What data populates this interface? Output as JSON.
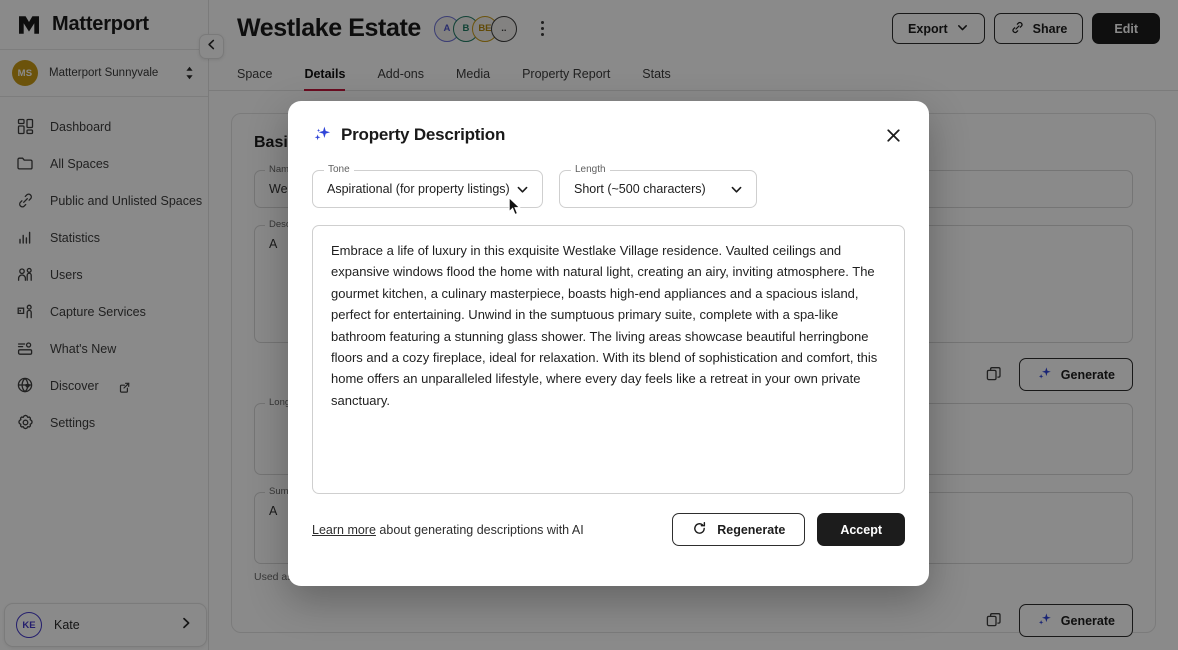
{
  "sidebar": {
    "brand": "Matterport",
    "brand_logo_icon": "matterport-logo-icon",
    "collapse_icon": "chevron-left-icon",
    "org": {
      "initials": "MS",
      "name": "Matterport Sunnyvale",
      "sort_icon": "sort-updown-icon",
      "avatar_color": "#c79a15"
    },
    "items": [
      {
        "label": "Dashboard",
        "icon": "dashboard-grid-icon",
        "external": false
      },
      {
        "label": "All Spaces",
        "icon": "folder-icon",
        "external": false
      },
      {
        "label": "Public and Unlisted Spaces",
        "icon": "link-chain-icon",
        "external": false
      },
      {
        "label": "Statistics",
        "icon": "bar-chart-icon",
        "external": false
      },
      {
        "label": "Users",
        "icon": "users-icon",
        "external": false
      },
      {
        "label": "Capture Services",
        "icon": "camera-person-icon",
        "external": false
      },
      {
        "label": "What's New",
        "icon": "list-toggle-icon",
        "external": false
      },
      {
        "label": "Discover",
        "icon": "globe-heart-icon",
        "external": true
      },
      {
        "label": "Settings",
        "icon": "gear-icon",
        "external": false
      }
    ],
    "user": {
      "initials": "KE",
      "name": "Kate",
      "chevron_icon": "chevron-right-icon",
      "ring_color": "#4338ca"
    }
  },
  "header": {
    "title": "Westlake Estate",
    "avatars": [
      {
        "initials": "A",
        "ring": "#6d72d6",
        "text": "#4f55c9"
      },
      {
        "initials": "B",
        "ring": "#1f7a63",
        "text": "#1f7a63"
      },
      {
        "initials": "BE",
        "ring": "#c79a15",
        "text": "#b5890d"
      },
      {
        "initials": "..",
        "ring": "#3a3a3a",
        "text": "#3a3a3a"
      }
    ],
    "kebab_icon": "more-vertical-icon",
    "actions": {
      "export_label": "Export",
      "export_chevron_icon": "chevron-down-icon",
      "share_label": "Share",
      "share_icon": "link-chain-icon",
      "edit_label": "Edit"
    }
  },
  "tabs": [
    {
      "label": "Space",
      "active": false
    },
    {
      "label": "Details",
      "active": true
    },
    {
      "label": "Add-ons",
      "active": false
    },
    {
      "label": "Media",
      "active": false
    },
    {
      "label": "Property Report",
      "active": false
    },
    {
      "label": "Stats",
      "active": false
    }
  ],
  "tab_accent": "#c4173c",
  "background_panel": {
    "card_title": "Basic Info",
    "fields": [
      {
        "label": "Name",
        "value": "Westlake Estate"
      },
      {
        "label": "Description",
        "value": "A"
      },
      {
        "label": "Long Description",
        "value": ""
      },
      {
        "label": "Summary",
        "value": "A"
      }
    ],
    "generate_label": "Generate",
    "generate_icon": "sparkle-icon",
    "copy_icon": "copy-icon",
    "helper_text": "Used as preview text on shared links, social media, and search results"
  },
  "modal": {
    "sparkle_icon": "sparkle-icon",
    "title": "Property Description",
    "close_icon": "close-x-icon",
    "tone": {
      "label": "Tone",
      "value": "Aspirational (for property listings)",
      "chevron_icon": "chevron-down-icon"
    },
    "length": {
      "label": "Length",
      "value": "Short (~500 characters)",
      "chevron_icon": "chevron-down-icon"
    },
    "description": "Embrace a life of luxury in this exquisite Westlake Village residence. Vaulted ceilings and expansive windows flood the home with natural light, creating an airy, inviting atmosphere. The gourmet kitchen, a culinary masterpiece, boasts high-end appliances and a spacious island, perfect for entertaining. Unwind in the sumptuous primary suite, complete with a spa-like bathroom featuring a stunning glass shower. The living areas showcase beautiful herringbone floors and a cozy fireplace, ideal for relaxation. With its blend of sophistication and comfort, this home offers an unparalleled lifestyle, where every day feels like a retreat in your own private sanctuary.",
    "footer": {
      "learn_link": "Learn more",
      "learn_rest": " about generating descriptions with AI",
      "regenerate_label": "Regenerate",
      "regenerate_icon": "refresh-icon",
      "accept_label": "Accept"
    },
    "accent_sparkle_color": "#2f44d8",
    "accept_bg": "#1c1c1c"
  },
  "cursor": {
    "icon": "mouse-pointer-icon"
  }
}
